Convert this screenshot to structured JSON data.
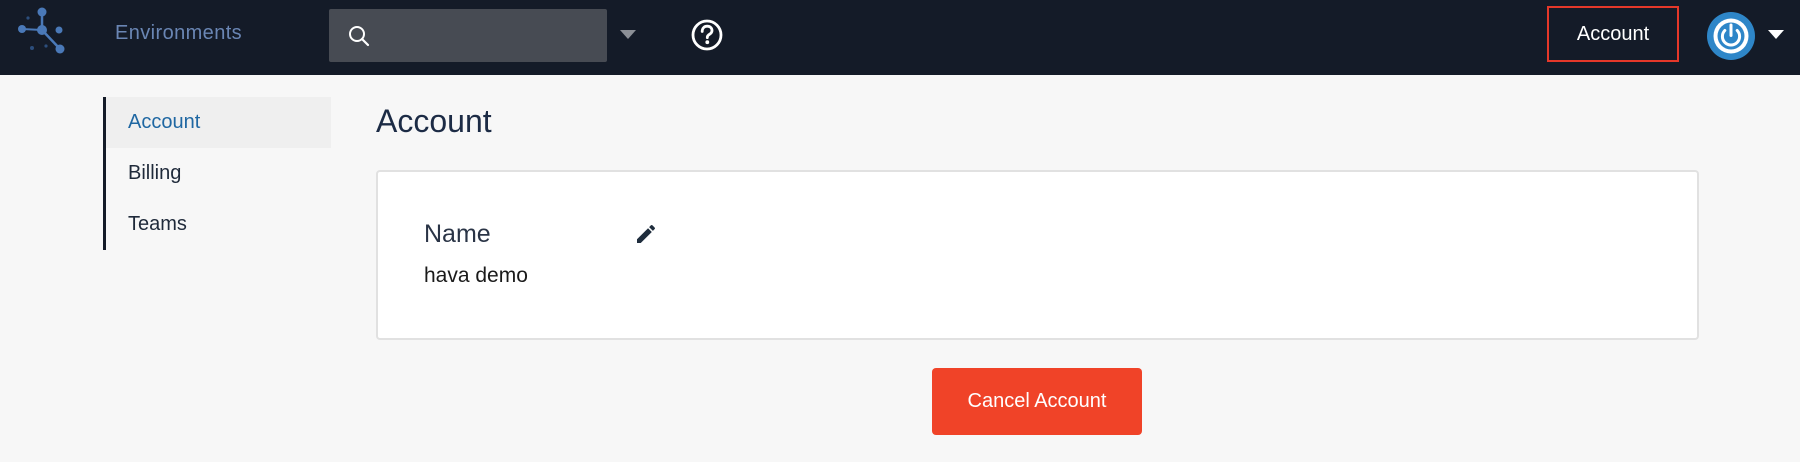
{
  "header": {
    "nav_environments": "Environments",
    "search": {
      "value": "",
      "placeholder": ""
    },
    "account_label": "Account",
    "colors": {
      "background": "#141b28",
      "highlight_border": "#e5382a"
    }
  },
  "sidebar": {
    "items": [
      {
        "label": "Account",
        "active": true
      },
      {
        "label": "Billing",
        "active": false
      },
      {
        "label": "Teams",
        "active": false
      }
    ]
  },
  "main": {
    "title": "Account",
    "card": {
      "field_label": "Name",
      "field_value": "hava demo"
    },
    "cancel_button_label": "Cancel Account",
    "colors": {
      "cancel_button": "#f04328",
      "active_link": "#1f67a2"
    }
  },
  "icons": [
    "logo-icon",
    "search-icon",
    "caret-down-icon",
    "help-icon",
    "power-icon",
    "pencil-icon"
  ]
}
